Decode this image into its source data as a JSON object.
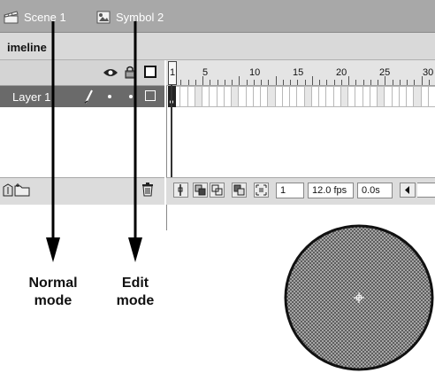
{
  "scene_bar": {
    "scene_label": "Scene 1",
    "symbol_label": "Symbol 2",
    "scene_icon": "clapperboard-icon",
    "symbol_icon": "graphic-symbol-icon"
  },
  "timeline": {
    "panel_title": "imeline",
    "layer_name": "Layer 1",
    "ruler_numbers": [
      "1",
      "5",
      "10",
      "15",
      "20",
      "25",
      "30"
    ],
    "current_frame": "1",
    "frame_rate": "12.0 fps",
    "elapsed_time": "0.0s"
  },
  "captions": {
    "normal_mode": [
      "Normal",
      "mode"
    ],
    "edit_mode": [
      "Edit",
      "mode"
    ]
  }
}
